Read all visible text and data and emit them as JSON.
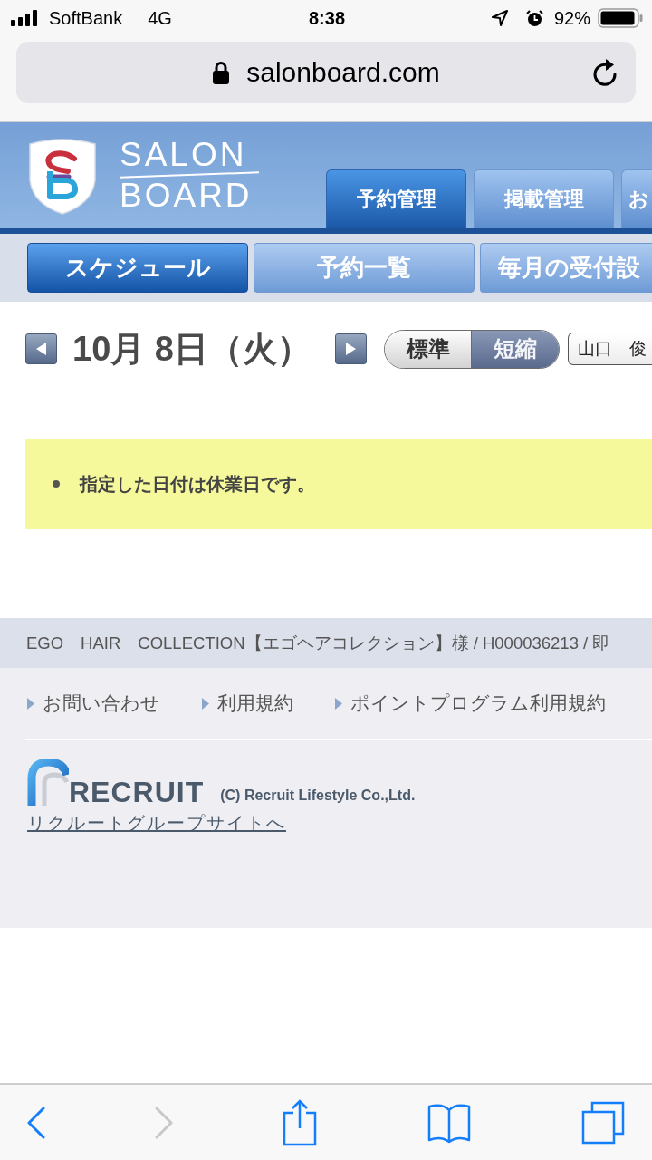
{
  "status_bar": {
    "carrier": "SoftBank",
    "network": "4G",
    "time": "8:38",
    "battery": "92%"
  },
  "address_bar": {
    "url": "salonboard.com"
  },
  "header": {
    "logo": {
      "top": "SALON",
      "bottom": "BOARD"
    },
    "tabs": [
      {
        "label": "予約管理",
        "selected": true
      },
      {
        "label": "掲載管理",
        "selected": false
      },
      {
        "label": "お",
        "selected": false
      }
    ]
  },
  "sub_tabs": [
    {
      "label": "スケジュール",
      "selected": true
    },
    {
      "label": "予約一覧",
      "selected": false
    },
    {
      "label": "毎月の受付設",
      "selected": false
    }
  ],
  "schedule": {
    "date": "10月 8日（火）",
    "view_toggle": [
      {
        "label": "標準",
        "selected": false
      },
      {
        "label": "短縮",
        "selected": true
      }
    ],
    "staff_select": {
      "value": "山口　俊"
    }
  },
  "notice": {
    "messages": [
      "指定した日付は休業日です。"
    ]
  },
  "footer": {
    "account_line": "EGO　HAIR　COLLECTION【エゴヘアコレクション】様 / H000036213 / 即",
    "links": [
      "お問い合わせ",
      "利用規約",
      "ポイントプログラム利用規約"
    ],
    "logo_text": "RECRUIT",
    "copyright": "(C) Recruit Lifestyle Co.,Ltd.",
    "group_link": "リクルートグループサイトへ"
  },
  "browser_toolbar": [
    {
      "kind": "back",
      "disabled": false
    },
    {
      "kind": "forward",
      "disabled": true
    },
    {
      "kind": "share",
      "disabled": false
    },
    {
      "kind": "bookmarks",
      "disabled": false
    },
    {
      "kind": "tabs",
      "disabled": false
    }
  ]
}
